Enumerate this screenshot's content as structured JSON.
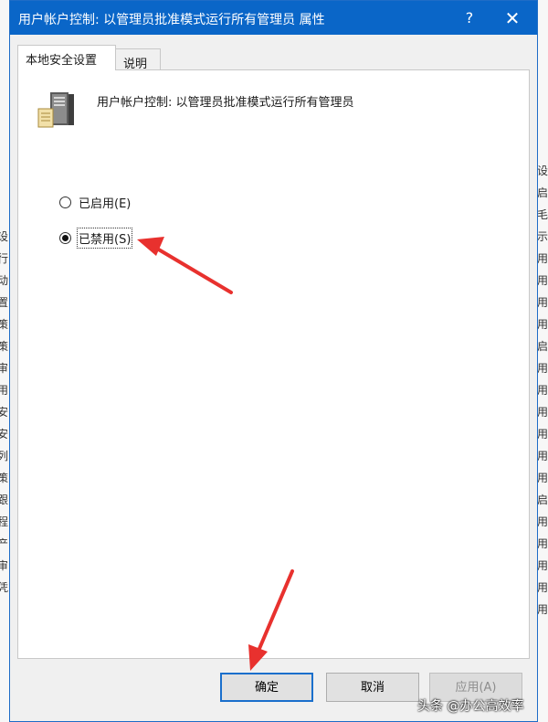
{
  "window": {
    "title": "用户帐户控制: 以管理员批准模式运行所有管理员 属性",
    "help_glyph": "?",
    "close_glyph": "✕"
  },
  "tabs": [
    {
      "label": "本地安全设置",
      "active": true
    },
    {
      "label": "说明",
      "active": false
    }
  ],
  "policy": {
    "icon": "server-icon",
    "name": "用户帐户控制: 以管理员批准模式运行所有管理员"
  },
  "options": [
    {
      "label": "已启用(E)",
      "checked": false
    },
    {
      "label": "已禁用(S)",
      "checked": true
    }
  ],
  "buttons": {
    "ok": "确定",
    "cancel": "取消",
    "apply": "应用(A)",
    "apply_disabled": true
  },
  "annotations": {
    "arrow_color": "#e8312e"
  },
  "background_window": {
    "left_chars": [
      "设",
      "行",
      "动",
      "置",
      "策",
      "策",
      "审",
      "用",
      "安",
      "安",
      "列",
      "策",
      "跟",
      "程",
      "产",
      "审",
      "凭"
    ],
    "right_chars": [
      "设",
      "启",
      "毛",
      "示",
      "用",
      "用",
      "用",
      "用",
      "启",
      "用",
      "用",
      "用",
      "用",
      "用",
      "用",
      "启",
      "用",
      "用",
      "用",
      "用",
      "用"
    ]
  },
  "watermark": "头条 @办公高效率"
}
